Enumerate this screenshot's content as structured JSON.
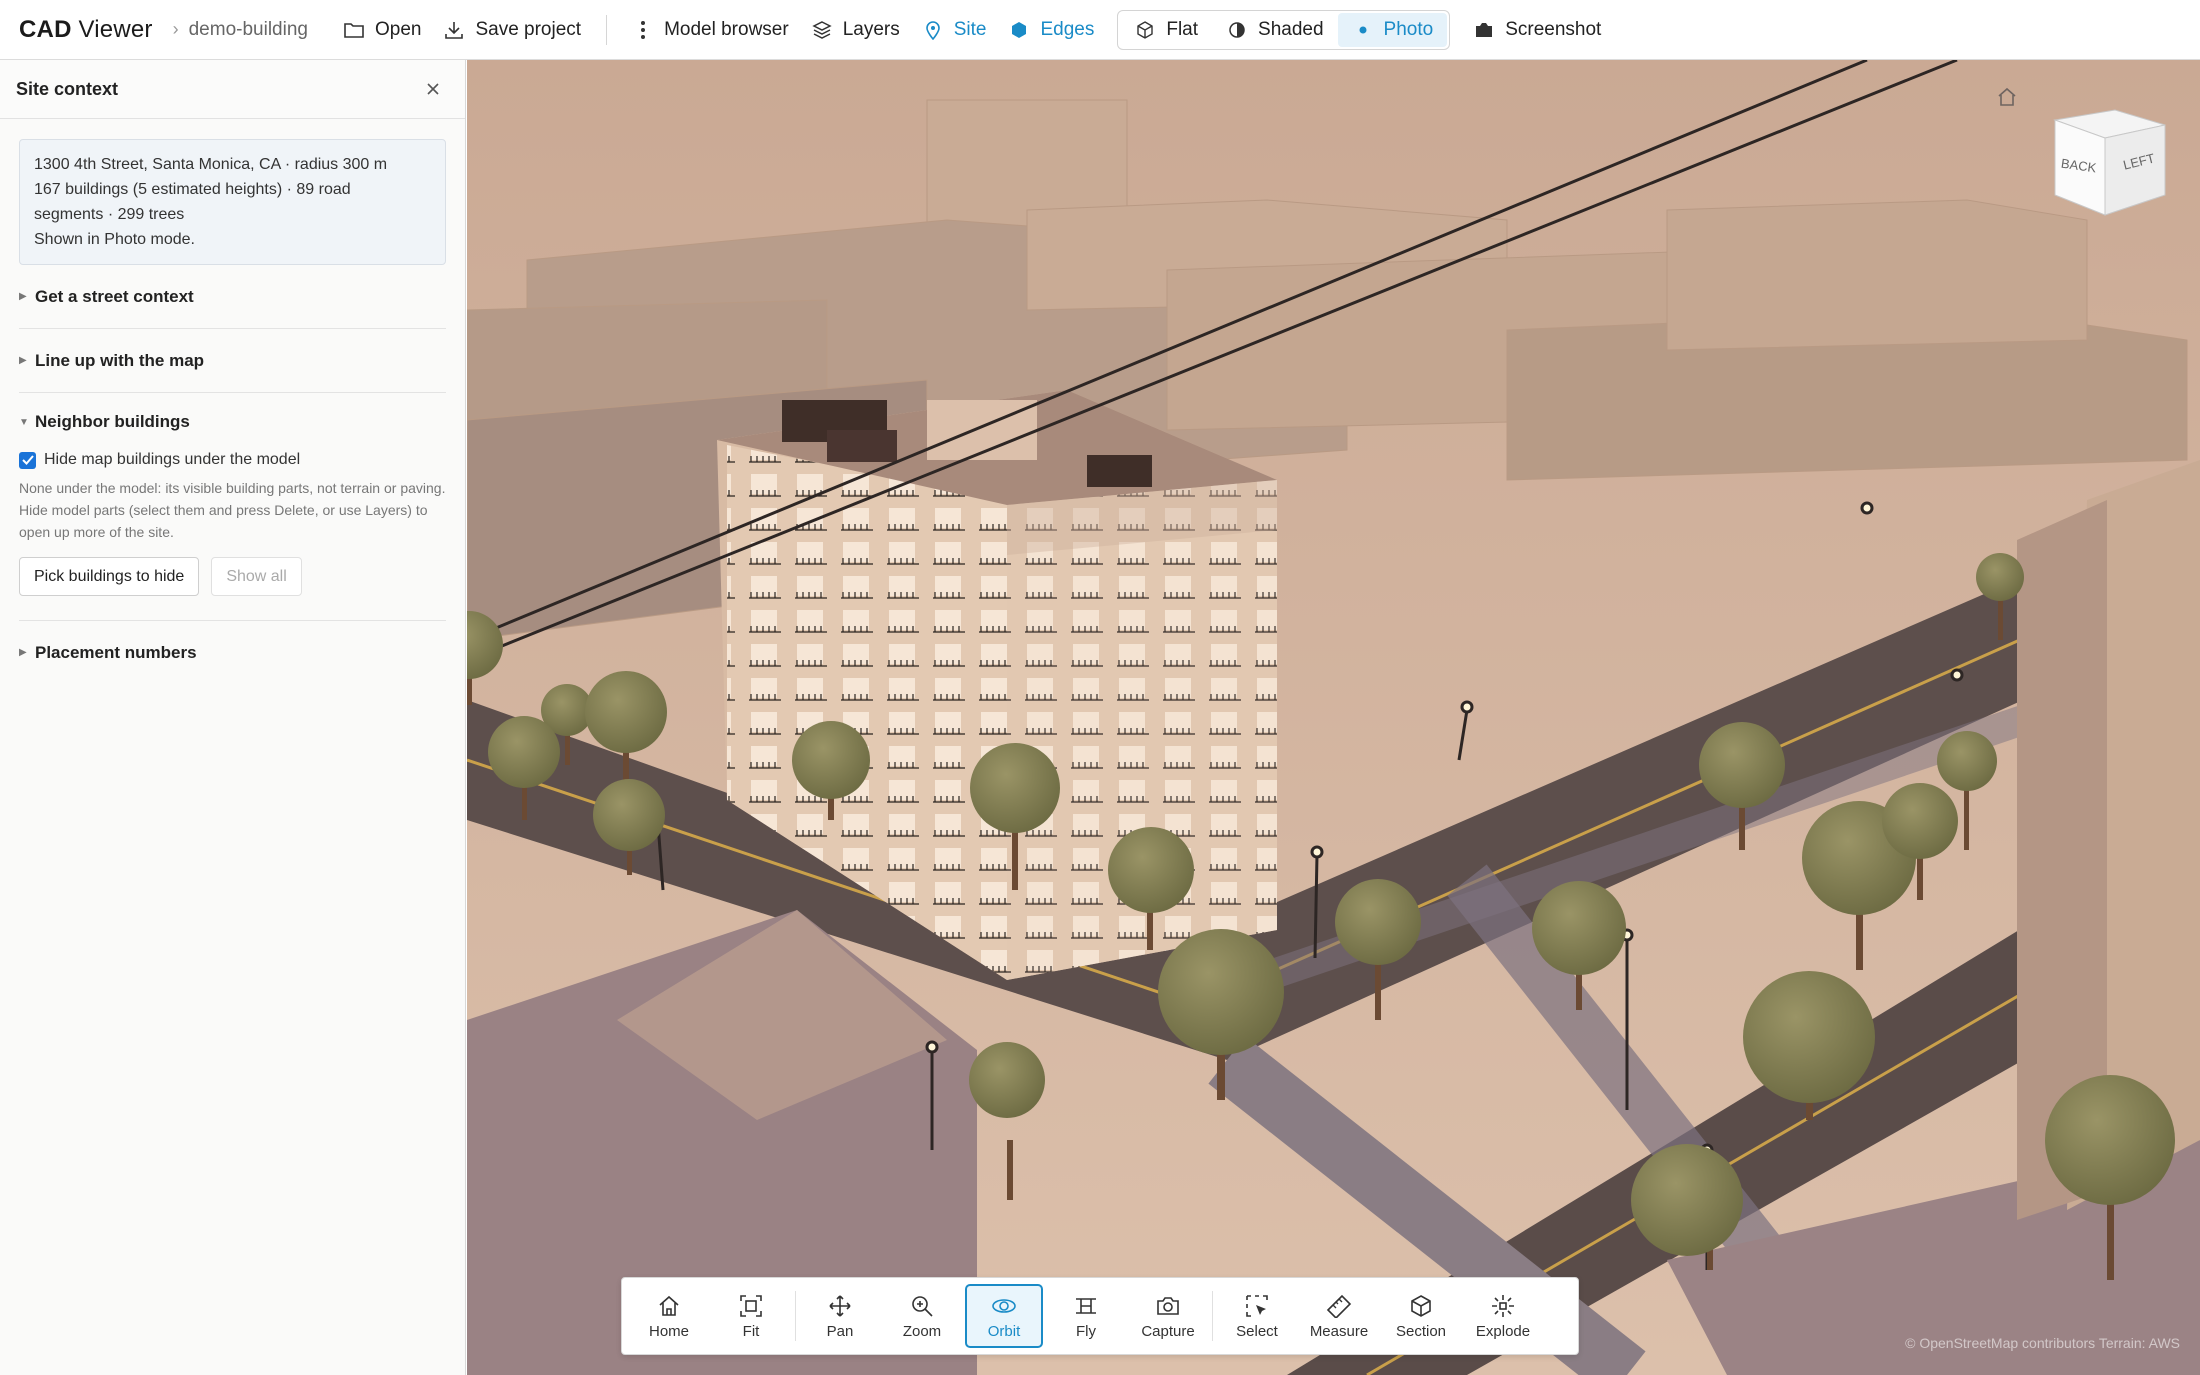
{
  "app": {
    "brand_bold": "CAD",
    "brand_rest": " Viewer",
    "project": "demo-building"
  },
  "toolbar": {
    "open": "Open",
    "save": "Save project",
    "model_browser": "Model browser",
    "layers": "Layers",
    "site": "Site",
    "edges": "Edges",
    "render_modes": [
      "Flat",
      "Shaded",
      "Photo"
    ],
    "render_mode_selected": "Photo",
    "screenshot": "Screenshot",
    "accent": "#1a8bc7"
  },
  "sidebar": {
    "title": "Site context",
    "info": {
      "line1": "1300 4th Street, Santa Monica, CA · radius 300 m",
      "line2": "167 buildings (5 estimated heights) · 89 road",
      "line3": "segments · 299 trees",
      "line4": "Shown in Photo mode."
    },
    "sections": {
      "street": "Get a street context",
      "lineup": "Line up with the map",
      "neighbors": "Neighbor buildings",
      "placement": "Placement numbers"
    },
    "neighbors": {
      "checkbox_label": "Hide map buildings under the model",
      "checkbox_checked": true,
      "hint": "None under the model: its visible building parts, not terrain or paving. Hide model parts (select them and press Delete, or use Layers) to open up more of the site.",
      "pick_button": "Pick buildings to hide",
      "show_all_button": "Show all"
    }
  },
  "viewport": {
    "viewcube": {
      "back": "BACK",
      "left": "LEFT"
    },
    "attribution": "© OpenStreetMap contributors   Terrain: AWS"
  },
  "tools": {
    "items": [
      {
        "label": "Home",
        "icon": "home-icon"
      },
      {
        "label": "Fit",
        "icon": "fit-icon"
      },
      {
        "label": "Pan",
        "icon": "pan-icon"
      },
      {
        "label": "Zoom",
        "icon": "zoom-icon"
      },
      {
        "label": "Orbit",
        "icon": "orbit-icon"
      },
      {
        "label": "Fly",
        "icon": "fly-icon"
      },
      {
        "label": "Capture",
        "icon": "camera-icon"
      },
      {
        "label": "Select",
        "icon": "select-icon"
      },
      {
        "label": "Measure",
        "icon": "ruler-icon"
      },
      {
        "label": "Section",
        "icon": "section-icon"
      },
      {
        "label": "Explode",
        "icon": "explode-icon"
      }
    ],
    "active": "Orbit"
  }
}
